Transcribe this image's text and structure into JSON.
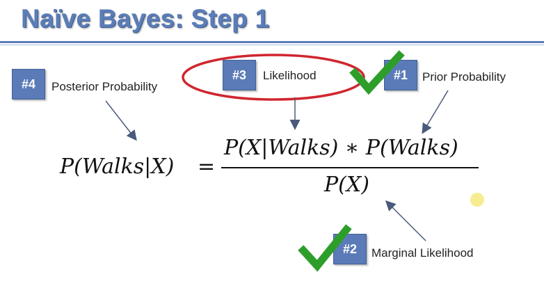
{
  "slide": {
    "title": "Naïve Bayes: Step 1"
  },
  "annotations": [
    {
      "number": "#4",
      "label": "Posterior Probability"
    },
    {
      "number": "#3",
      "label": "Likelihood"
    },
    {
      "number": "#1",
      "label": "Prior Probability"
    },
    {
      "number": "#2",
      "label": "Marginal Likelihood"
    }
  ],
  "formula": {
    "lhs": "P(Walks|X)",
    "equals": "=",
    "numerator": "P(X|Walks) ∗ P(Walks)",
    "denominator": "P(X)"
  },
  "colors": {
    "title": "#5b7db8",
    "badge": "#5a7bb8",
    "highlight_circle": "#d0262f",
    "checkmark": "#2e9e2a",
    "arrow": "#4a5a7a"
  }
}
